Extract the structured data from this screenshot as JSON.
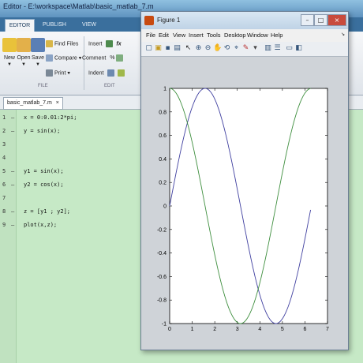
{
  "editor": {
    "title": "Editor - E:\\workspace\\Matlab\\basic_matlab_7.m",
    "tabs": [
      {
        "label": "EDITOR",
        "active": true
      },
      {
        "label": "PUBLISH",
        "active": false
      },
      {
        "label": "VIEW",
        "active": false
      }
    ],
    "ribbon": {
      "new_label": "New",
      "open_label": "Open",
      "save_label": "Save",
      "find_files_label": "Find Files",
      "compare_label": "Compare",
      "print_label": "Print",
      "file_group_label": "FILE",
      "insert_label": "Insert",
      "fx_label": "fx",
      "comment_label": "Comment",
      "percent_label": "%",
      "indent_label": "Indent",
      "edit_group_label": "EDIT"
    },
    "file_tab": "basic_matlab_7.m",
    "code_lines": [
      {
        "num": "1",
        "dash": "–",
        "text": "x = 0:0.01:2*pi;"
      },
      {
        "num": "2",
        "dash": "–",
        "text": "y = sin(x);"
      },
      {
        "num": "3",
        "dash": "",
        "text": ""
      },
      {
        "num": "4",
        "dash": "",
        "text": ""
      },
      {
        "num": "5",
        "dash": "–",
        "text": "y1 = sin(x);"
      },
      {
        "num": "6",
        "dash": "–",
        "text": "y2 = cos(x);"
      },
      {
        "num": "7",
        "dash": "",
        "text": ""
      },
      {
        "num": "8",
        "dash": "–",
        "text": "z = [y1 ; y2];"
      },
      {
        "num": "9",
        "dash": "–",
        "text": "plot(x,z);"
      }
    ]
  },
  "figure": {
    "title": "Figure 1",
    "menu": [
      "File",
      "Edit",
      "View",
      "Insert",
      "Tools",
      "Desktop",
      "Window",
      "Help"
    ],
    "toolbar_icons": [
      "new-figure-icon",
      "open-icon",
      "save-icon",
      "print-icon",
      "pointer-icon",
      "zoom-in-icon",
      "zoom-out-icon",
      "pan-icon",
      "rotate-icon",
      "data-cursor-icon",
      "brush-icon",
      "link-icon",
      "colorbar-icon",
      "legend-icon",
      "hide-plot-tools-icon",
      "show-plot-tools-icon"
    ]
  },
  "chart_data": {
    "type": "line",
    "x_range": [
      0,
      6.28
    ],
    "xlim": [
      0,
      7
    ],
    "ylim": [
      -1,
      1
    ],
    "xticks": [
      "0",
      "1",
      "2",
      "3",
      "4",
      "5",
      "6",
      "7"
    ],
    "yticks": [
      "1",
      "0.8",
      "0.6",
      "0.4",
      "0.2",
      "0",
      "-0.2",
      "-0.4",
      "-0.6",
      "-0.8",
      "-1"
    ],
    "series": [
      {
        "function": "sin(x)",
        "color": "#4040a0",
        "x": [
          0,
          0.79,
          1.57,
          2.36,
          3.14,
          3.93,
          4.71,
          5.5,
          6.28
        ],
        "y": [
          0,
          0.71,
          1,
          0.71,
          0,
          -0.71,
          -1,
          -0.71,
          0
        ]
      },
      {
        "function": "cos(x)",
        "color": "#3f8f3f",
        "x": [
          0,
          0.79,
          1.57,
          2.36,
          3.14,
          3.93,
          4.71,
          5.5,
          6.28
        ],
        "y": [
          1,
          0.71,
          0,
          -0.71,
          -1,
          -0.71,
          0,
          0.71,
          1
        ]
      }
    ],
    "grid": false
  }
}
